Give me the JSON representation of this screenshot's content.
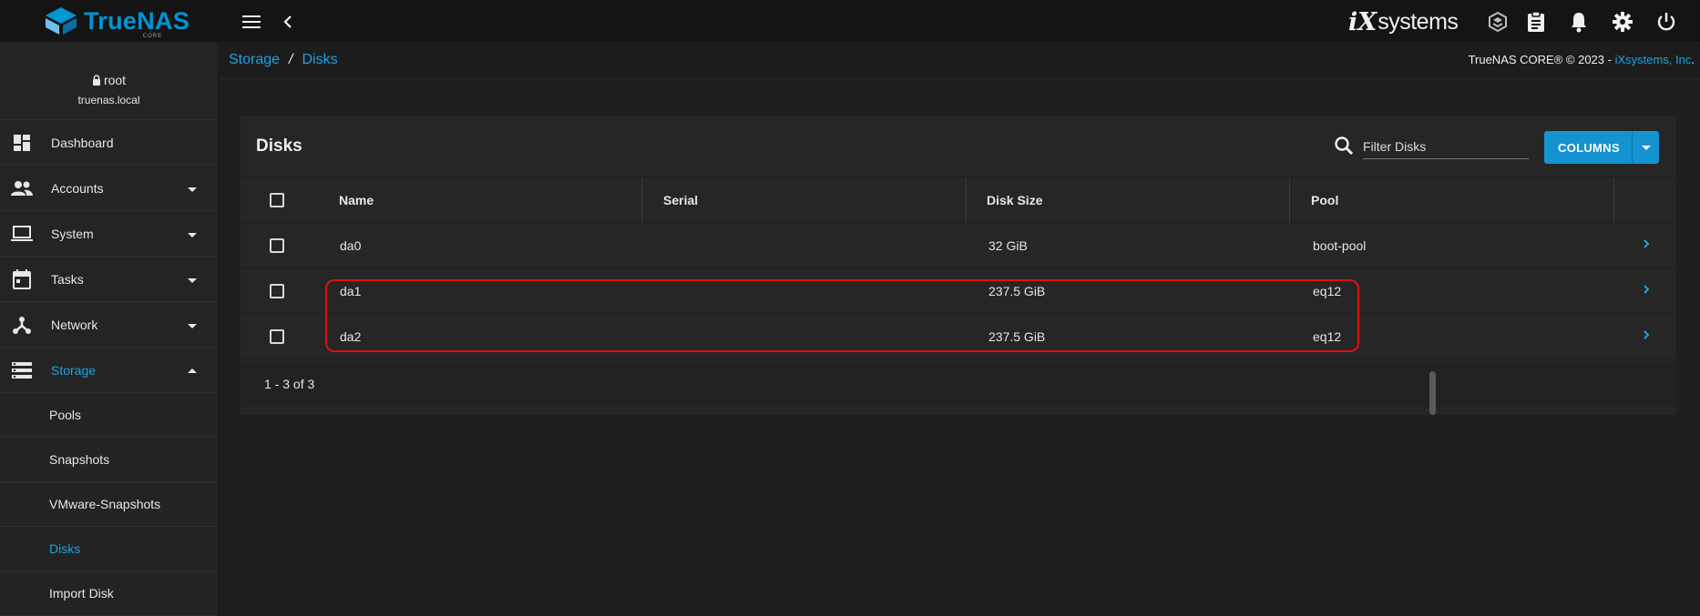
{
  "app": {
    "logo_text": "TrueNAS",
    "logo_sub": "CORE",
    "vendor_i": "iX",
    "vendor_text": "systems"
  },
  "topbar": {
    "icons": [
      "menu-icon",
      "chevron-left-icon",
      "truecommand-icon",
      "clipboard-icon",
      "bell-icon",
      "gear-icon",
      "power-icon"
    ]
  },
  "user": {
    "name": "root",
    "host": "truenas.local"
  },
  "sidebar": {
    "items": [
      {
        "label": "Dashboard",
        "icon": "dashboard-icon"
      },
      {
        "label": "Accounts",
        "icon": "accounts-icon"
      },
      {
        "label": "System",
        "icon": "laptop-icon"
      },
      {
        "label": "Tasks",
        "icon": "calendar-icon"
      },
      {
        "label": "Network",
        "icon": "network-icon"
      },
      {
        "label": "Storage",
        "icon": "storage-icon"
      }
    ],
    "storage_sub": [
      {
        "label": "Pools"
      },
      {
        "label": "Snapshots"
      },
      {
        "label": "VMware-Snapshots"
      },
      {
        "label": "Disks"
      },
      {
        "label": "Import Disk"
      }
    ]
  },
  "breadcrumb": {
    "items": [
      "Storage",
      "Disks"
    ],
    "separator": "/"
  },
  "copyright": {
    "text": "TrueNAS CORE® © 2023 - ",
    "link": "iXsystems, Inc",
    "trail": "."
  },
  "card": {
    "title": "Disks",
    "filter_placeholder": "Filter Disks",
    "columns_label": "COLUMNS"
  },
  "table": {
    "headers": [
      "Name",
      "Serial",
      "Disk Size",
      "Pool"
    ],
    "rows": [
      {
        "name": "da0",
        "serial": "",
        "size": "32 GiB",
        "pool": "boot-pool"
      },
      {
        "name": "da1",
        "serial": "",
        "size": "237.5 GiB",
        "pool": "eq12"
      },
      {
        "name": "da2",
        "serial": "",
        "size": "237.5 GiB",
        "pool": "eq12"
      }
    ],
    "pager": "1 - 3 of 3"
  },
  "colors": {
    "accent": "#1fa3e0",
    "button": "#1493d1",
    "highlight": "#e01010"
  }
}
